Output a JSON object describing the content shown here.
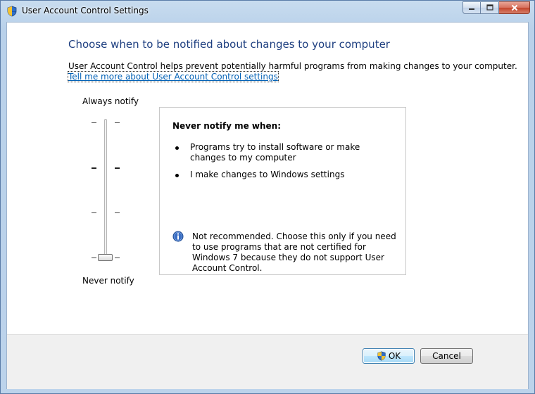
{
  "window": {
    "title": "User Account Control Settings",
    "title_icon": "uac-shield-icon",
    "controls": {
      "minimize": "minimize-icon",
      "maximize": "maximize-icon",
      "close": "close-icon"
    }
  },
  "main": {
    "heading": "Choose when to be notified about changes to your computer",
    "description": "User Account Control helps prevent potentially harmful programs from making changes to your computer.",
    "learn_more_link": "Tell me more about User Account Control settings"
  },
  "slider": {
    "top_label": "Always notify",
    "bottom_label": "Never notify",
    "levels": 4,
    "selected_level": 1
  },
  "info_box": {
    "title": "Never notify me when:",
    "bullets": [
      "Programs try to install software or make changes to my computer",
      "I make changes to Windows settings"
    ],
    "warning_icon": "info-icon",
    "warning_text": "Not recommended. Choose this only if you need to use programs that are not certified for Windows 7 because they do not support User Account Control."
  },
  "buttons": {
    "ok_label": "OK",
    "cancel_label": "Cancel"
  },
  "colors": {
    "heading": "#1e3f80",
    "link": "#0060b6",
    "titlebar": "#b9d1ea"
  }
}
